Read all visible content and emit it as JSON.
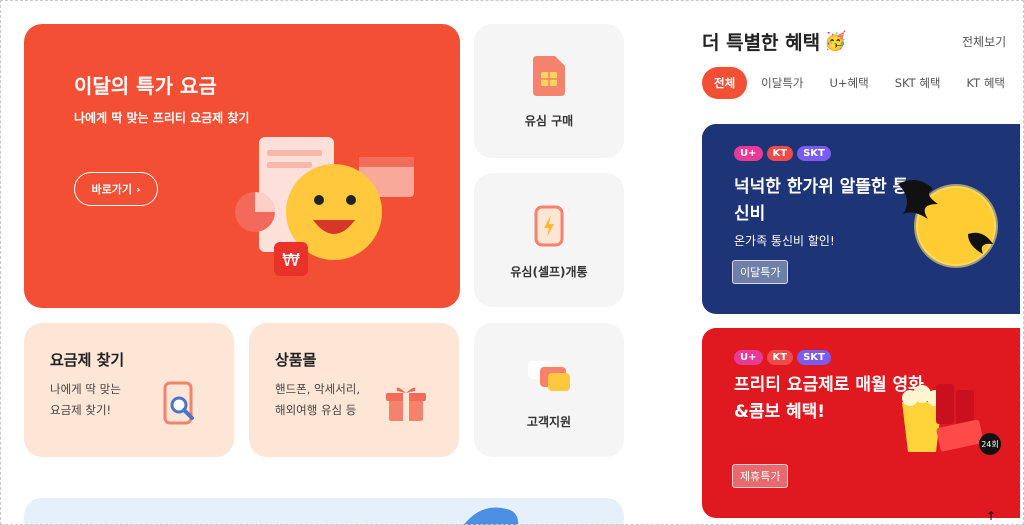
{
  "hero": {
    "title": "이달의 특가 요금",
    "subtitle": "나에게 딱 맞는 프리티 요금제 찾기",
    "button_label": "바로가기",
    "badge_symbol": "₩"
  },
  "tiles": {
    "usim_buy": "유심 구매",
    "usim_self_open": "유심(셀프)개통",
    "support": "고객지원"
  },
  "plan_finder": {
    "title": "요금제 찾기",
    "desc": "나에게 딱 맞는 요금제 찾기!"
  },
  "shop": {
    "title": "상품몰",
    "desc": "핸드폰, 악세서리, 해외여행 유심 등"
  },
  "benefits": {
    "title": "더 특별한 혜택",
    "emoji": "🥳",
    "view_all": "전체보기",
    "tabs": [
      "전체",
      "이달특가",
      "U+혜택",
      "SKT 혜택",
      "KT 혜택"
    ],
    "active_tab": 0,
    "promos": [
      {
        "badges": [
          "U+",
          "KT",
          "SKT"
        ],
        "title": "넉넉한 한가위 알뜰한 통신비",
        "subtitle": "온가족 통신비 할인!",
        "tag": "이달특가"
      },
      {
        "badges": [
          "U+",
          "KT",
          "SKT"
        ],
        "title": "프리티 요금제로 매월 영화&콤보 혜택!",
        "tag": "제휴특가",
        "sticker": "24회"
      }
    ]
  },
  "colors": {
    "brand": "#f24f35",
    "navy_promo": "#1d3577",
    "red_promo": "#e0181f",
    "peach": "#fde6d5",
    "grey_tile": "#f5f5f5"
  }
}
